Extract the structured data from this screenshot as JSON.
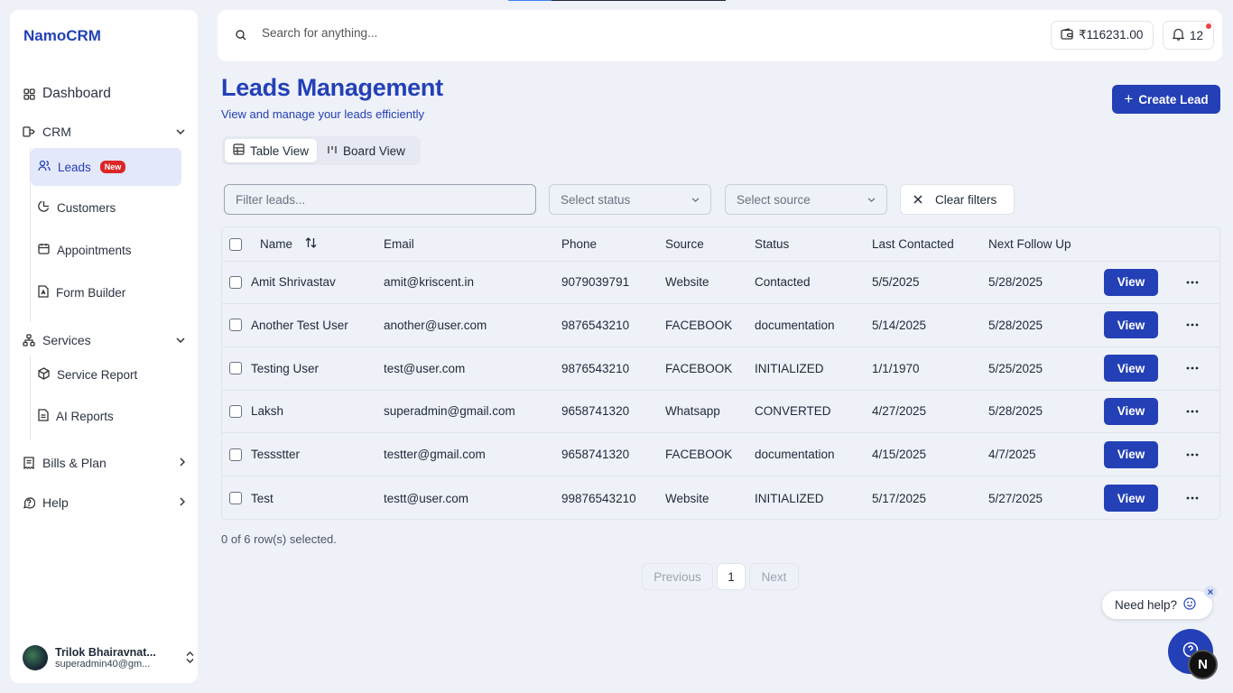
{
  "app": {
    "brand": "NamoCRM"
  },
  "sidebar": {
    "dashboard": "Dashboard",
    "crm": "CRM",
    "leads": "Leads",
    "leads_badge": "New",
    "customers": "Customers",
    "appointments": "Appointments",
    "form_builder": "Form Builder",
    "services": "Services",
    "service_report": "Service Report",
    "ai_reports": "AI Reports",
    "bills_plan": "Bills & Plan",
    "help": "Help"
  },
  "user": {
    "name": "Trilok Bhairavnat...",
    "email": "superadmin40@gm..."
  },
  "topbar": {
    "search_placeholder": "Search for anything...",
    "balance": "₹116231.00",
    "notifications": "12"
  },
  "header": {
    "title": "Leads Management",
    "subtitle": "View and manage your leads efficiently",
    "create_label": "Create Lead"
  },
  "views": {
    "table": "Table View",
    "board": "Board View"
  },
  "filters": {
    "placeholder": "Filter leads...",
    "status": "Select status",
    "source": "Select source",
    "clear": "Clear filters"
  },
  "table": {
    "columns": {
      "name": "Name",
      "email": "Email",
      "phone": "Phone",
      "source": "Source",
      "status": "Status",
      "last": "Last Contacted",
      "next": "Next Follow Up"
    },
    "view_label": "View",
    "rows": [
      {
        "name": "Amit Shrivastav",
        "email": "amit@kriscent.in",
        "phone": "9079039791",
        "source": "Website",
        "status": "Contacted",
        "last": "5/5/2025",
        "next": "5/28/2025"
      },
      {
        "name": "Another Test User",
        "email": "another@user.com",
        "phone": "9876543210",
        "source": "FACEBOOK",
        "status": "documentation",
        "last": "5/14/2025",
        "next": "5/28/2025"
      },
      {
        "name": "Testing User",
        "email": "test@user.com",
        "phone": "9876543210",
        "source": "FACEBOOK",
        "status": "INITIALIZED",
        "last": "1/1/1970",
        "next": "5/25/2025"
      },
      {
        "name": "Laksh",
        "email": "superadmin@gmail.com",
        "phone": "9658741320",
        "source": "Whatsapp",
        "status": "CONVERTED",
        "last": "4/27/2025",
        "next": "5/28/2025"
      },
      {
        "name": "Tessstter",
        "email": "testter@gmail.com",
        "phone": "9658741320",
        "source": "FACEBOOK",
        "status": "documentation",
        "last": "4/15/2025",
        "next": "4/7/2025"
      },
      {
        "name": "Test",
        "email": "testt@user.com",
        "phone": "99876543210",
        "source": "Website",
        "status": "INITIALIZED",
        "last": "5/17/2025",
        "next": "5/27/2025"
      }
    ]
  },
  "footer": {
    "selected": "0 of 6 row(s) selected.",
    "previous": "Previous",
    "page": "1",
    "next": "Next"
  },
  "help_widget": {
    "label": "Need help?",
    "badge": "N"
  },
  "colors": {
    "primary": "#2340b6",
    "background": "#eef1f8",
    "danger": "#dc2626"
  }
}
